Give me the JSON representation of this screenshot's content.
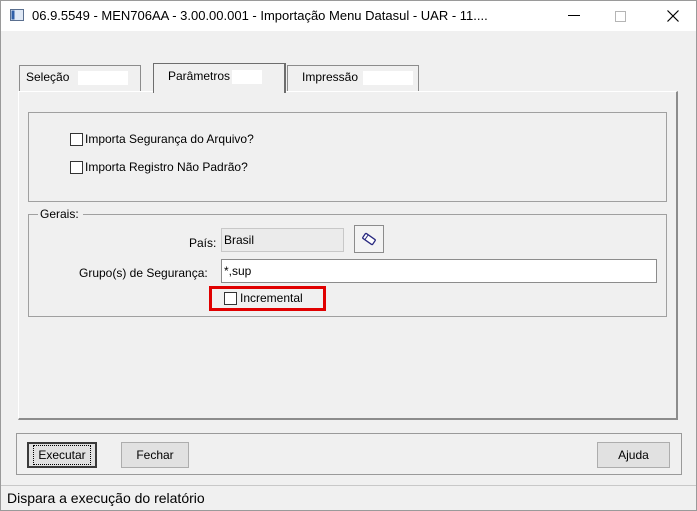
{
  "window": {
    "title": "06.9.5549 - MEN706AA - 3.00.00.001 - Importação Menu Datasul - UAR - 11...."
  },
  "tabs": [
    {
      "label": "Seleção",
      "active": false
    },
    {
      "label": "Parâmetros",
      "active": true
    },
    {
      "label": "Impressão",
      "active": false
    }
  ],
  "options": {
    "import_security": {
      "label": "Importa Segurança do Arquivo?",
      "checked": false
    },
    "import_non_standard": {
      "label": "Importa Registro Não Padrão?",
      "checked": false
    }
  },
  "gerais": {
    "caption": "Gerais:",
    "pais_label": "País:",
    "pais_value": "Brasil",
    "grupos_label": "Grupo(s) de Segurança:",
    "grupos_value": "*,sup",
    "incremental": {
      "label": "Incremental",
      "checked": false
    }
  },
  "buttons": {
    "executar": "Executar",
    "fechar": "Fechar",
    "ajuda": "Ajuda"
  },
  "status": {
    "text": "Dispara a execução do relatório"
  },
  "colors": {
    "highlight": "#e00000",
    "background": "#f0f0f0"
  }
}
